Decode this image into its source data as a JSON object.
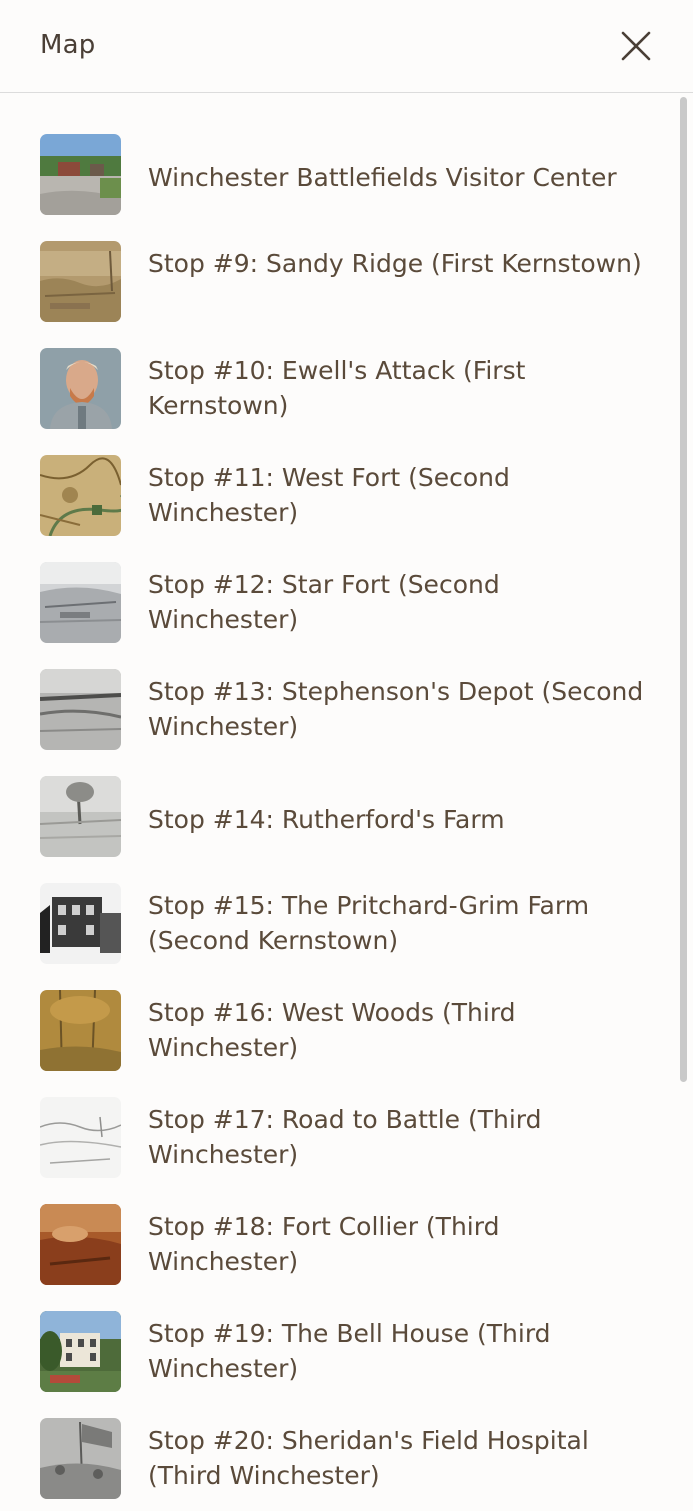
{
  "header": {
    "title": "Map",
    "close_icon": "close-icon"
  },
  "stops": [
    {
      "label": "Winchester Battlefields Visitor Center",
      "thumb": "visitor-center-photo"
    },
    {
      "label": "Stop #9: Sandy Ridge (First Kernstown)",
      "thumb": "sandy-ridge-sketch"
    },
    {
      "label": "Stop #10: Ewell's Attack (First Kernstown)",
      "thumb": "ewell-portrait"
    },
    {
      "label": "Stop #11: West Fort (Second Winchester)",
      "thumb": "west-fort-map"
    },
    {
      "label": "Stop #12: Star Fort (Second Winchester)",
      "thumb": "star-fort-photo"
    },
    {
      "label": "Stop #13: Stephenson's Depot (Second Winchester)",
      "thumb": "stephensons-depot-sketch"
    },
    {
      "label": "Stop #14: Rutherford's Farm",
      "thumb": "rutherfords-farm-photo"
    },
    {
      "label": "Stop #15: The Pritchard-Grim Farm (Second Kernstown)",
      "thumb": "pritchard-grim-house-photo"
    },
    {
      "label": "Stop #16: West Woods (Third Winchester)",
      "thumb": "west-woods-sketch"
    },
    {
      "label": "Stop #17: Road to Battle (Third Winchester)",
      "thumb": "road-to-battle-sketch"
    },
    {
      "label": "Stop #18: Fort Collier (Third Winchester)",
      "thumb": "fort-collier-painting"
    },
    {
      "label": "Stop #19: The Bell House (Third Winchester)",
      "thumb": "bell-house-photo"
    },
    {
      "label": "Stop #20: Sheridan's Field Hospital (Third Winchester)",
      "thumb": "field-hospital-photo"
    }
  ]
}
